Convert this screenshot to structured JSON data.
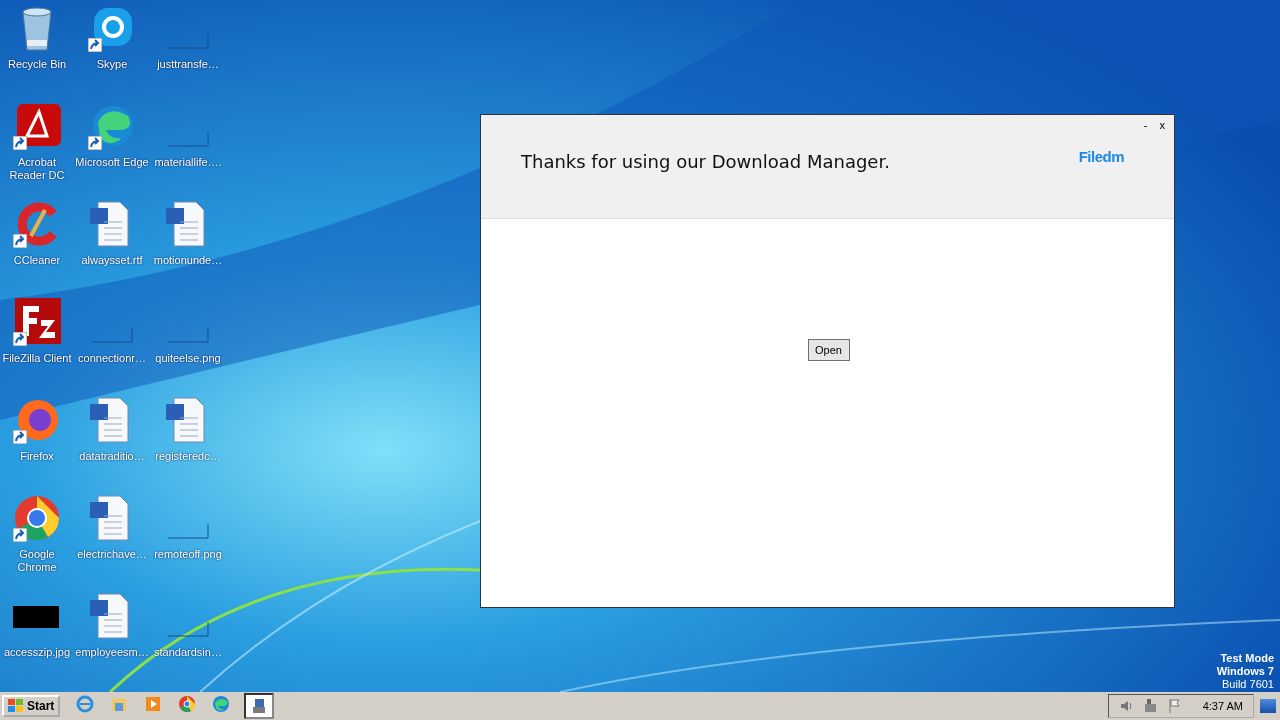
{
  "desktop_icons": [
    {
      "label": "Recycle Bin",
      "kind": "recycle",
      "shortcut": false
    },
    {
      "label": "Skype",
      "kind": "skype",
      "shortcut": true
    },
    {
      "label": "justtransfe…",
      "kind": "blank",
      "shortcut": false
    },
    {
      "label": "Acrobat Reader DC",
      "kind": "pdf",
      "shortcut": true
    },
    {
      "label": "Microsoft Edge",
      "kind": "edge",
      "shortcut": true
    },
    {
      "label": "materiallife….",
      "kind": "blank",
      "shortcut": false
    },
    {
      "label": "CCleaner",
      "kind": "ccleaner",
      "shortcut": true
    },
    {
      "label": "alwaysset.rtf",
      "kind": "word",
      "shortcut": false
    },
    {
      "label": "motionunde…",
      "kind": "word",
      "shortcut": false
    },
    {
      "label": "FileZilla Client",
      "kind": "filezilla",
      "shortcut": true
    },
    {
      "label": "connectionr…",
      "kind": "blank",
      "shortcut": false
    },
    {
      "label": "quiteelse.png",
      "kind": "blank",
      "shortcut": false
    },
    {
      "label": "Firefox",
      "kind": "firefox",
      "shortcut": true
    },
    {
      "label": "datatraditio…",
      "kind": "word",
      "shortcut": false
    },
    {
      "label": "registeredc…",
      "kind": "word",
      "shortcut": false
    },
    {
      "label": "Google Chrome",
      "kind": "chrome",
      "shortcut": true
    },
    {
      "label": "electrichave…",
      "kind": "word",
      "shortcut": false
    },
    {
      "label": "remoteoff.png",
      "kind": "blank",
      "shortcut": false
    },
    {
      "label": "accesszip.jpg",
      "kind": "black",
      "shortcut": false
    },
    {
      "label": "employeesm…",
      "kind": "word",
      "shortcut": false
    },
    {
      "label": "standardsin…",
      "kind": "blank",
      "shortcut": false
    }
  ],
  "window": {
    "heading": "Thanks for using our Download Manager.",
    "logo": "Filedm",
    "minimize": "-",
    "close": "x",
    "button": "Open"
  },
  "watermark_lines": [
    "Test Mode",
    "Windows 7",
    "Build 7601"
  ],
  "taskbar": {
    "start": "Start",
    "apps": [
      {
        "kind": "ie",
        "selected": false
      },
      {
        "kind": "folder",
        "selected": false
      },
      {
        "kind": "media",
        "selected": false
      },
      {
        "kind": "chrome",
        "selected": false
      },
      {
        "kind": "edge",
        "selected": false
      },
      {
        "kind": "installer",
        "selected": true
      }
    ],
    "clock": "4:37 AM"
  }
}
